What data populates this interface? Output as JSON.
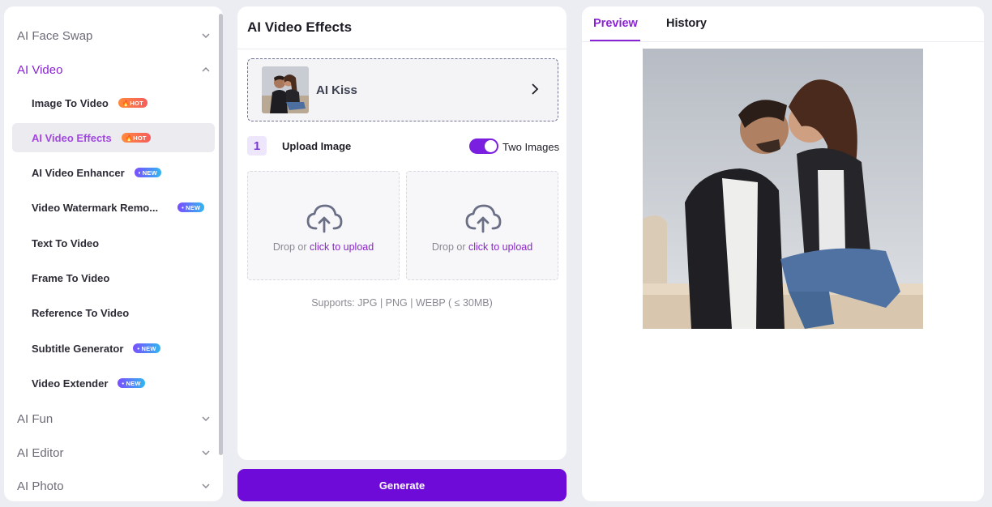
{
  "sidebar": {
    "sections": [
      {
        "label": "AI Face Swap",
        "expanded": false
      },
      {
        "label": "AI Video",
        "expanded": true
      },
      {
        "label": "AI Fun",
        "expanded": false
      },
      {
        "label": "AI Editor",
        "expanded": false
      },
      {
        "label": "AI Photo",
        "expanded": false
      }
    ],
    "video_items": [
      {
        "label": "Image To Video",
        "badge": "HOT"
      },
      {
        "label": "AI Video Effects",
        "badge": "HOT",
        "selected": true
      },
      {
        "label": "AI Video Enhancer",
        "badge": "NEW"
      },
      {
        "label": "Video Watermark Remo...",
        "badge": "NEW"
      },
      {
        "label": "Text To Video",
        "badge": ""
      },
      {
        "label": "Frame To Video",
        "badge": ""
      },
      {
        "label": "Reference To Video",
        "badge": ""
      },
      {
        "label": "Subtitle Generator",
        "badge": "NEW"
      },
      {
        "label": "Video Extender",
        "badge": "NEW"
      }
    ],
    "badge_labels": {
      "hot": "HOT",
      "new": "• NEW"
    }
  },
  "editor": {
    "title": "AI Video Effects",
    "effect_name": "AI Kiss",
    "step_number": "1",
    "upload_label": "Upload Image",
    "two_images_label": "Two Images",
    "two_images_enabled": true,
    "drop_prefix": "Drop or ",
    "drop_link": "click to upload",
    "supports": "Supports: JPG | PNG | WEBP ( ≤ 30MB)",
    "generate_label": "Generate"
  },
  "preview": {
    "tabs": [
      {
        "label": "Preview",
        "active": true
      },
      {
        "label": "History",
        "active": false
      }
    ]
  },
  "colors": {
    "accent": "#8a23d6",
    "generate": "#6e0bd8",
    "toggle_on": "#7a1fe0",
    "hot_badge": "#ff7a45",
    "new_badge": "#5a7bff"
  },
  "icons": [
    "chevron-down-icon",
    "chevron-up-icon",
    "fire-icon",
    "chevron-right-icon",
    "cloud-upload-icon"
  ]
}
